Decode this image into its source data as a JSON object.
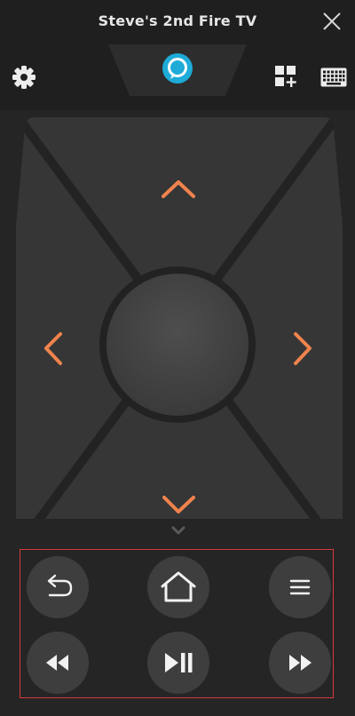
{
  "window": {
    "title": "Steve's 2nd Fire TV"
  },
  "icons": {
    "close": "close-icon",
    "settings": "gear-icon",
    "alexa": "alexa-ring-icon",
    "apps": "apps-grid-plus-icon",
    "keyboard": "keyboard-icon",
    "dpad_up": "chevron-up-icon",
    "dpad_down": "chevron-down-icon",
    "dpad_left": "chevron-left-icon",
    "dpad_right": "chevron-right-icon",
    "collapse": "small-chevron-down-icon",
    "back": "back-arrow-icon",
    "home": "home-icon",
    "menu": "hamburger-menu-icon",
    "rewind": "rewind-icon",
    "play_pause": "play-pause-icon",
    "fast_forward": "fast-forward-icon"
  },
  "colors": {
    "accent_orange": "#f0834d",
    "alexa_blue": "#1eabd8",
    "panel_red_border": "#d33b3b",
    "background": "#252525",
    "button": "#3e3e3e"
  }
}
